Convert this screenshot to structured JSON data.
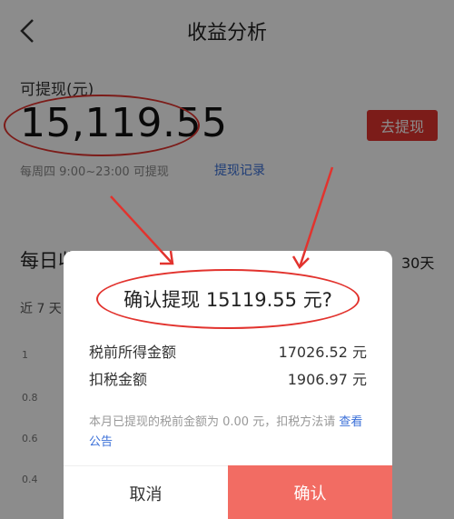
{
  "header": {
    "title": "收益分析",
    "back_icon": "chevron-left-icon"
  },
  "balance": {
    "label": "可提现(元)",
    "amount": "15,119.55",
    "withdraw_label": "去提现",
    "schedule": "每周四 9:00~23:00 可提现",
    "record_link": "提现记录"
  },
  "daily": {
    "title": "每日收",
    "range_30": "30天",
    "range_7": "近 7 天",
    "yticks": [
      "1",
      "0.8",
      "0.6",
      "0.4"
    ]
  },
  "dialog": {
    "title": "确认提现 15119.55 元?",
    "rows": [
      {
        "label": "税前所得金额",
        "value": "17026.52 元"
      },
      {
        "label": "扣税金额",
        "value": "1906.97 元"
      }
    ],
    "note": "本月已提现的税前金额为 0.00 元，扣税方法请",
    "note_link": "查看公告",
    "cancel_label": "取消",
    "confirm_label": "确认"
  },
  "colors": {
    "accent_red": "#e2332e",
    "confirm_bg": "#f26c63",
    "link_blue": "#3a6fd8"
  }
}
